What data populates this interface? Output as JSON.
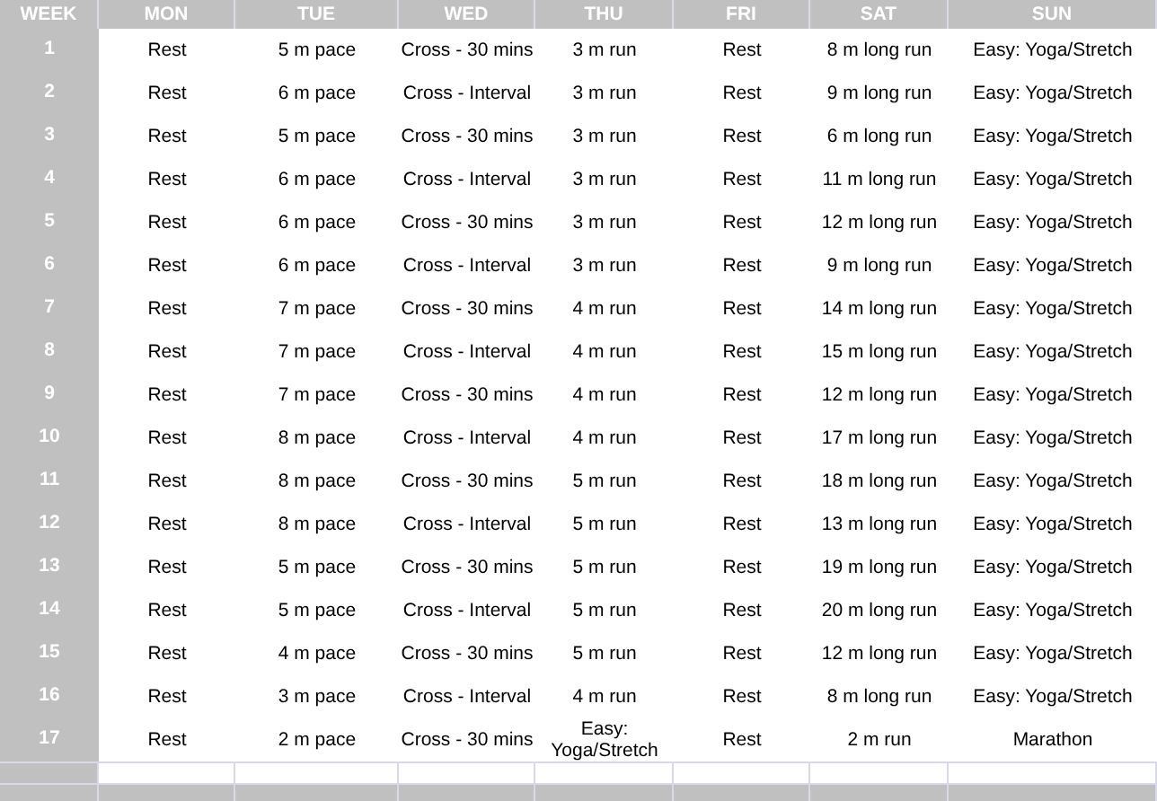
{
  "table": {
    "columns": [
      "WEEK",
      "MON",
      "TUE",
      "WED",
      "THU",
      "FRI",
      "SAT",
      "SUN"
    ],
    "rows": [
      {
        "cells": [
          "1",
          "Rest",
          "5 m pace",
          "Cross - 30 mins",
          "3 m run",
          "Rest",
          "8 m long run",
          "Easy: Yoga/Stretch"
        ]
      },
      {
        "cells": [
          "2",
          "Rest",
          "6 m pace",
          "Cross - Interval",
          "3 m run",
          "Rest",
          "9 m long run",
          "Easy: Yoga/Stretch"
        ]
      },
      {
        "cells": [
          "3",
          "Rest",
          "5 m pace",
          "Cross - 30 mins",
          "3 m run",
          "Rest",
          "6 m long run",
          "Easy: Yoga/Stretch"
        ]
      },
      {
        "cells": [
          "4",
          "Rest",
          "6 m pace",
          "Cross - Interval",
          "3 m run",
          "Rest",
          "11 m long run",
          "Easy: Yoga/Stretch"
        ]
      },
      {
        "cells": [
          "5",
          "Rest",
          "6 m pace",
          "Cross - 30 mins",
          "3 m run",
          "Rest",
          "12 m long run",
          "Easy: Yoga/Stretch"
        ]
      },
      {
        "cells": [
          "6",
          "Rest",
          "6 m pace",
          "Cross - Interval",
          "3 m run",
          "Rest",
          "9 m long run",
          "Easy: Yoga/Stretch"
        ]
      },
      {
        "cells": [
          "7",
          "Rest",
          "7 m pace",
          "Cross - 30 mins",
          "4 m run",
          "Rest",
          "14 m long run",
          "Easy: Yoga/Stretch"
        ]
      },
      {
        "cells": [
          "8",
          "Rest",
          "7 m pace",
          "Cross - Interval",
          "4 m run",
          "Rest",
          "15 m long run",
          "Easy: Yoga/Stretch"
        ]
      },
      {
        "cells": [
          "9",
          "Rest",
          "7 m pace",
          "Cross - 30 mins",
          "4 m run",
          "Rest",
          "12 m long run",
          "Easy: Yoga/Stretch"
        ]
      },
      {
        "cells": [
          "10",
          "Rest",
          "8 m pace",
          "Cross - Interval",
          "4 m run",
          "Rest",
          "17 m long run",
          "Easy: Yoga/Stretch"
        ]
      },
      {
        "cells": [
          "11",
          "Rest",
          "8 m pace",
          "Cross - 30 mins",
          "5 m run",
          "Rest",
          "18 m long run",
          "Easy: Yoga/Stretch"
        ]
      },
      {
        "cells": [
          "12",
          "Rest",
          "8 m pace",
          "Cross - Interval",
          "5 m run",
          "Rest",
          "13 m long run",
          "Easy: Yoga/Stretch"
        ]
      },
      {
        "cells": [
          "13",
          "Rest",
          "5 m pace",
          "Cross - 30 mins",
          "5 m run",
          "Rest",
          "19 m long run",
          "Easy: Yoga/Stretch"
        ]
      },
      {
        "cells": [
          "14",
          "Rest",
          "5 m pace",
          "Cross - Interval",
          "5 m run",
          "Rest",
          "20 m long run",
          "Easy: Yoga/Stretch"
        ]
      },
      {
        "cells": [
          "15",
          "Rest",
          "4 m pace",
          "Cross - 30 mins",
          "5 m run",
          "Rest",
          "12 m long run",
          "Easy: Yoga/Stretch"
        ]
      },
      {
        "cells": [
          "16",
          "Rest",
          "3 m pace",
          "Cross - Interval",
          "4 m run",
          "Rest",
          "8 m long run",
          "Easy: Yoga/Stretch"
        ]
      },
      {
        "cells": [
          "17",
          "Rest",
          "2 m pace",
          "Cross - 30 mins",
          "Easy: Yoga/Stretch",
          "Rest",
          "2 m run",
          "Marathon"
        ]
      }
    ]
  }
}
